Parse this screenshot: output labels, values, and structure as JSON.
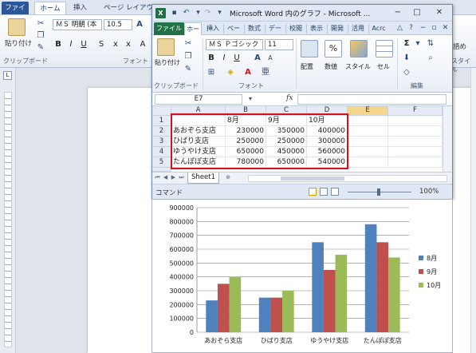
{
  "word": {
    "tabs": [
      "ファイル",
      "ホーム",
      "挿入",
      "ページ レイアウト"
    ],
    "ribbon": {
      "paste_label": "貼り付け",
      "clipboard_label": "クリップボード",
      "font_name": "ＭＳ 明朝 (本",
      "font_size": "10.5",
      "font_group_label": "フォント",
      "right_label_1": "語め",
      "right_label_2": "スタイル"
    }
  },
  "excel": {
    "title": "Microsoft Word 内のグラフ - Microsoft ...",
    "window_buttons": [
      "−",
      "□",
      "✕"
    ],
    "tabs": [
      "ファイル",
      "ホー",
      "挿入",
      "ペー",
      "数式",
      "デー",
      "校閲",
      "表示",
      "開発",
      "活用",
      "Acrc"
    ],
    "ribbon": {
      "paste_label": "貼り付け",
      "clipboard_label": "クリップボード",
      "font_name": "ＭＳ Ｐゴシック",
      "font_size": "11",
      "font_group_label": "フォント",
      "alignment_label": "配置",
      "number_label": "数値",
      "style_label": "スタイル",
      "cell_label": "セル",
      "edit_label": "編集"
    },
    "name_box": "E7",
    "fx": "fx",
    "columns": [
      "A",
      "B",
      "C",
      "D",
      "E",
      "F"
    ],
    "rows": [
      "1",
      "2",
      "3",
      "4",
      "5",
      "6"
    ],
    "header_row": [
      "",
      "8月",
      "9月",
      "10月"
    ],
    "data_rows": [
      [
        "あおぞら支店",
        "230000",
        "350000",
        "400000"
      ],
      [
        "ひばり支店",
        "250000",
        "250000",
        "300000"
      ],
      [
        "ゆうやけ支店",
        "650000",
        "450000",
        "560000"
      ],
      [
        "たんぽぽ支店",
        "780000",
        "650000",
        "540000"
      ]
    ],
    "sheet_tab": "Sheet1",
    "status_mode": "コマンド",
    "zoom": "100%"
  },
  "colors": {
    "series": [
      "#4f81bd",
      "#c0504d",
      "#9bbb59"
    ],
    "highlight": "#d3121b",
    "excel_file_tab": "#217346",
    "word_file_tab": "#2a5797"
  },
  "chart_data": {
    "type": "bar",
    "categories": [
      "あおぞら支店",
      "ひばり支店",
      "ゆうやけ支店",
      "たんぽぽ支店"
    ],
    "series": [
      {
        "name": "8月",
        "values": [
          230000,
          250000,
          650000,
          780000
        ]
      },
      {
        "name": "9月",
        "values": [
          350000,
          250000,
          450000,
          650000
        ]
      },
      {
        "name": "10月",
        "values": [
          400000,
          300000,
          560000,
          540000
        ]
      }
    ],
    "y_ticks": [
      "0",
      "100000",
      "200000",
      "300000",
      "400000",
      "500000",
      "600000",
      "700000",
      "800000",
      "900000"
    ],
    "ylim": [
      0,
      900000
    ],
    "grid": true,
    "legend_position": "right",
    "title": "",
    "xlabel": "",
    "ylabel": ""
  }
}
